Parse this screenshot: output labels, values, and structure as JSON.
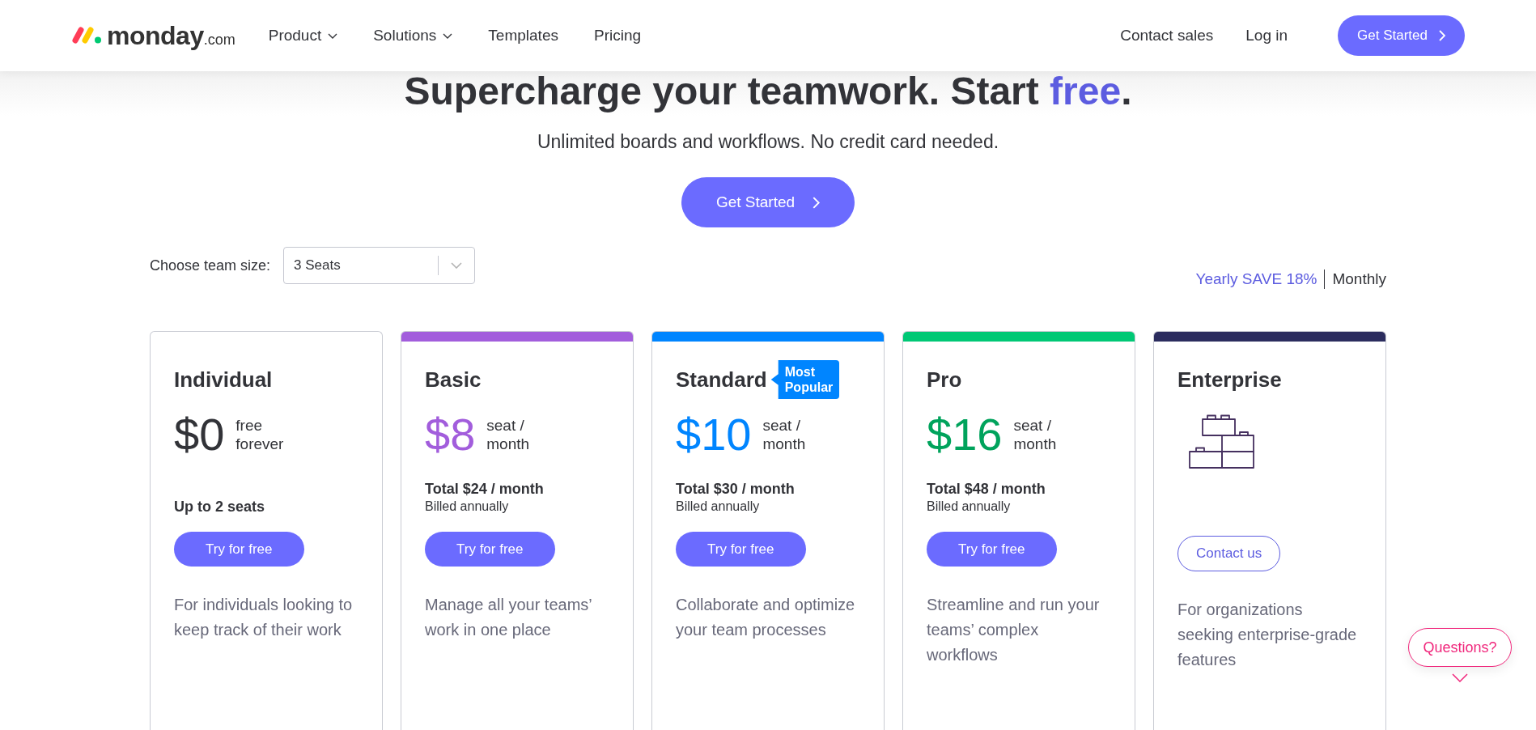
{
  "header": {
    "logo": {
      "name": "monday",
      "suffix": ".com"
    },
    "nav": [
      {
        "label": "Product",
        "dropdown": true
      },
      {
        "label": "Solutions",
        "dropdown": true
      },
      {
        "label": "Templates",
        "dropdown": false
      },
      {
        "label": "Pricing",
        "dropdown": false
      }
    ],
    "links": [
      "Contact sales",
      "Log in"
    ],
    "cta": "Get Started"
  },
  "hero": {
    "title": "Supercharge your teamwork. Start **free**.",
    "subtitle": "Unlimited boards and workflows. No credit card needed.",
    "cta": "Get Started"
  },
  "team_size": {
    "label": "Choose team size:",
    "value": "3 Seats"
  },
  "billing": [
    {
      "label": "Yearly SAVE 18%",
      "selected": true
    },
    {
      "label": "Monthly",
      "selected": false
    }
  ],
  "plans": [
    {
      "kind": "priced",
      "name": "Individual",
      "price": {
        "amount": "$0",
        "unit": "free forever",
        "color": "#323338"
      },
      "seats": "Up to 2 seats",
      "button": {
        "label": "Try for free",
        "kind": "primary"
      },
      "description": "For individuals looking to keep track of their work"
    },
    {
      "kind": "priced",
      "name": "Basic",
      "color": "#a25ddc",
      "price": {
        "amount": "$8",
        "unit": "seat / month",
        "color": "#a25ddc"
      },
      "total": "Total $24 / month",
      "billing": "Billed annually",
      "button": {
        "label": "Try for free",
        "kind": "primary"
      },
      "description": "Manage all your teams’ work in one place"
    },
    {
      "kind": "priced",
      "name": "Standard",
      "color": "#0085ff",
      "badge": "Most Popular",
      "price": {
        "amount": "$10",
        "unit": "seat / month",
        "color": "#0085ff"
      },
      "total": "Total $30 / month",
      "billing": "Billed annually",
      "button": {
        "label": "Try for free",
        "kind": "primary"
      },
      "description": "Collaborate and optimize your team processes"
    },
    {
      "kind": "priced",
      "name": "Pro",
      "color": "#00c875",
      "price": {
        "amount": "$16",
        "unit": "seat / month",
        "color": "#00a35c"
      },
      "total": "Total $48 / month",
      "billing": "Billed annually",
      "button": {
        "label": "Try for free",
        "kind": "primary"
      },
      "description": "Streamline and run your teams’ complex workflows"
    },
    {
      "kind": "contact",
      "name": "Enterprise",
      "color": "#2b2c5e",
      "button": {
        "label": "Contact us",
        "kind": "outline"
      },
      "description": "For organizations seeking enterprise-grade features"
    }
  ],
  "help": {
    "label": "Questions?"
  }
}
